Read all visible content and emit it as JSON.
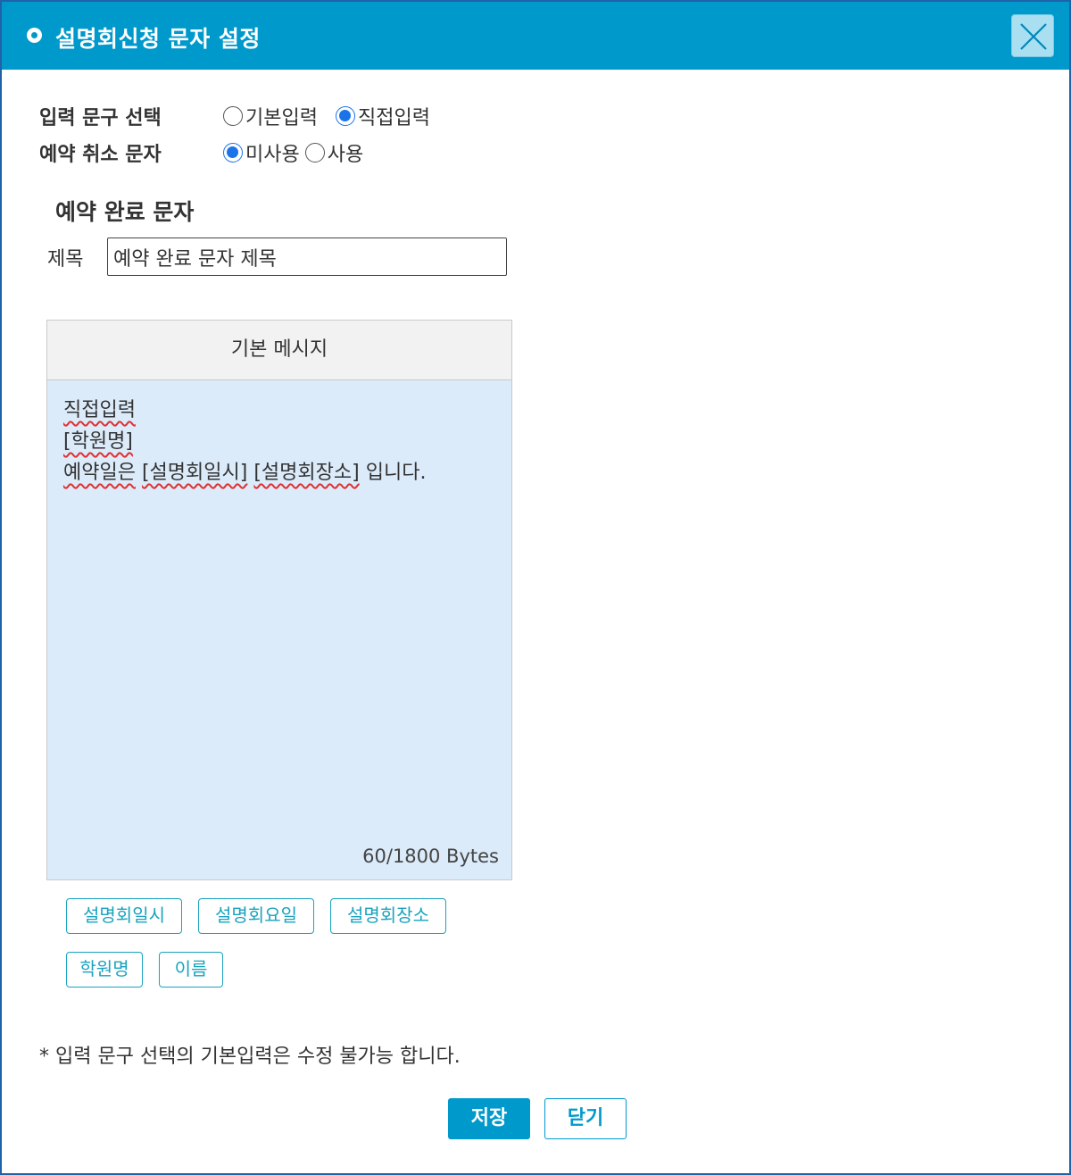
{
  "dialog": {
    "title": "설명회신청 문자 설정",
    "close_icon": "close-x-icon"
  },
  "options": {
    "input_phrase": {
      "label": "입력 문구 선택",
      "choices": [
        "기본입력",
        "직접입력"
      ],
      "selected": "직접입력"
    },
    "cancel_message": {
      "label": "예약 취소 문자",
      "choices": [
        "미사용",
        "사용"
      ],
      "selected": "미사용"
    }
  },
  "complete_message": {
    "section_title": "예약 완료 문자",
    "subject_label": "제목",
    "subject_value": "예약 완료 문자 제목",
    "box_header": "기본 메시지",
    "body_lines": {
      "line1": "직접입력",
      "line2": "[학원명]",
      "line3_a": "예약일은",
      "line3_b": "[설명회일시]",
      "line3_c": "[설명회장소]",
      "line3_d": "입니다."
    },
    "byte_count": "60/1800 Bytes"
  },
  "tags": [
    "설명회일시",
    "설명회요일",
    "설명회장소",
    "학원명",
    "이름"
  ],
  "note": "* 입력 문구 선택의 기본입력은 수정 불가능 합니다.",
  "buttons": {
    "save": "저장",
    "close": "닫기"
  },
  "colors": {
    "titlebar": "#0099cc",
    "message_body": "#dcebfa",
    "tag_accent": "#1aa3bf",
    "radio_selected": "#1a73e8"
  }
}
